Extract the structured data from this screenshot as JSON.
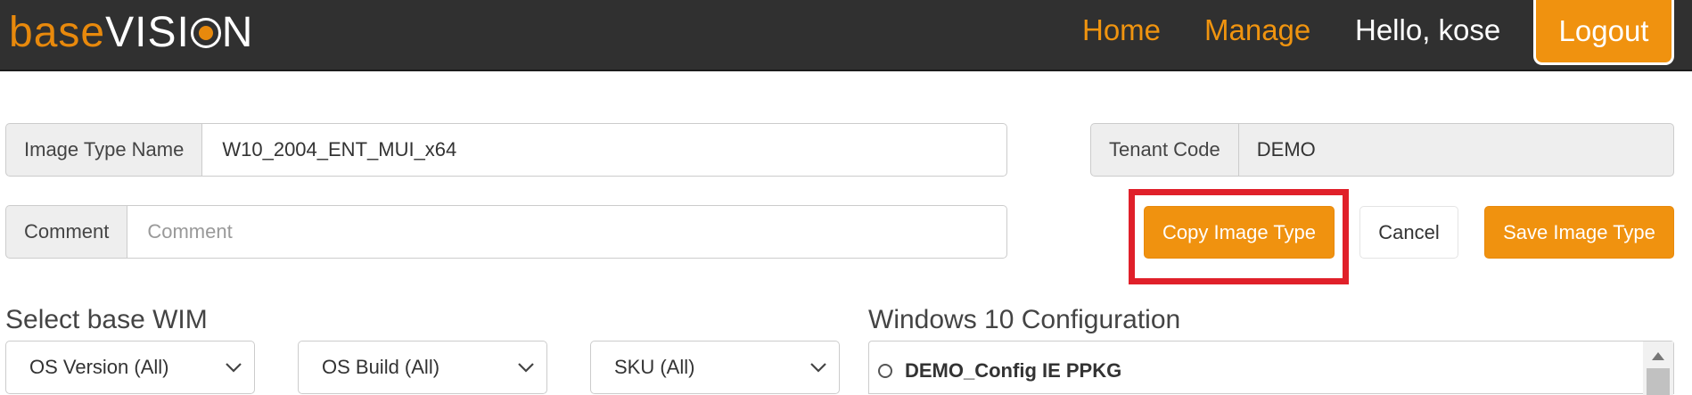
{
  "navbar": {
    "logo": {
      "base": "base",
      "vision_before": "VISI",
      "vision_after": "N"
    },
    "home_label": "Home",
    "manage_label": "Manage",
    "greeting": "Hello, kose",
    "logout_label": "Logout"
  },
  "form": {
    "image_type_name": {
      "label": "Image Type Name",
      "value": "W10_2004_ENT_MUI_x64"
    },
    "tenant_code": {
      "label": "Tenant Code",
      "value": "DEMO"
    },
    "comment": {
      "label": "Comment",
      "placeholder": "Comment",
      "value": ""
    }
  },
  "actions": {
    "copy_label": "Copy Image Type",
    "cancel_label": "Cancel",
    "save_label": "Save Image Type"
  },
  "base_wim": {
    "title": "Select base WIM",
    "filters": [
      {
        "selected": "OS Version (All)"
      },
      {
        "selected": "OS Build (All)"
      },
      {
        "selected": "SKU (All)"
      }
    ]
  },
  "config": {
    "title": "Windows 10 Configuration",
    "items": [
      {
        "label": "DEMO_Config IE PPKG",
        "selected": false
      }
    ]
  },
  "colors": {
    "accent": "#f0920f",
    "navbar_bg": "#303030",
    "highlight": "#e0202a"
  }
}
